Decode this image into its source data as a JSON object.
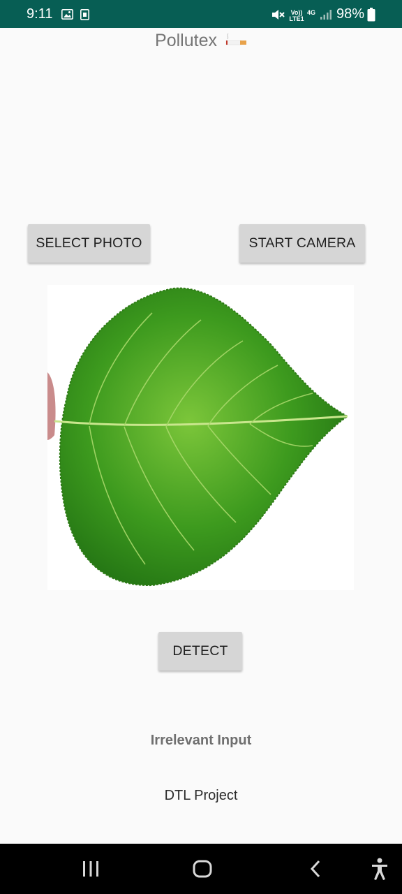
{
  "status_bar": {
    "time": "9:11",
    "volte_label": "Vo)) LTE1",
    "network_label": "4G",
    "battery": "98%",
    "icons": [
      "gallery-icon",
      "screenshot-icon",
      "mute-icon",
      "signal-icon",
      "battery-icon"
    ]
  },
  "app": {
    "title": "Pollutex",
    "title_icon": "cigarette-icon"
  },
  "buttons": {
    "select_photo": "SELECT PHOTO",
    "start_camera": "START CAMERA",
    "detect": "DETECT"
  },
  "image": {
    "subject": "leaf",
    "colors": {
      "leaf_main": "#3d9a1e",
      "leaf_light": "#7cc63a",
      "leaf_dark": "#1f6e12",
      "background": "#ffffff"
    }
  },
  "result_text": "Irrelevant Input",
  "footer_text": "DTL Project",
  "nav_bar": {
    "icons": [
      "recent-apps-icon",
      "home-icon",
      "back-icon",
      "accessibility-icon"
    ]
  },
  "colors": {
    "status_bar": "#075e54",
    "background": "#fafafa",
    "button": "#d6d6d6"
  }
}
